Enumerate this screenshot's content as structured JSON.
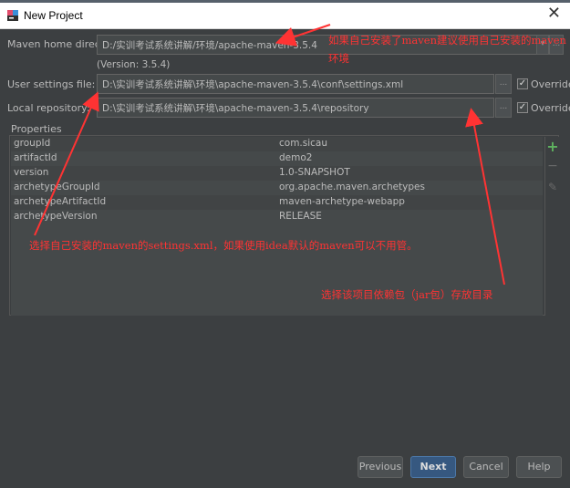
{
  "window": {
    "title": "New Project",
    "close_glyph": "✕"
  },
  "form": {
    "maven_home_label": "Maven home directory:",
    "maven_home_value": "D:/实训考试系统讲解/环境/apache-maven-3.5.4",
    "version_text": "(Version: 3.5.4)",
    "settings_label": "User settings file:",
    "settings_value": "D:\\实训考试系统讲解\\环境\\apache-maven-3.5.4\\conf\\settings.xml",
    "repo_label": "Local repository:",
    "repo_value": "D:\\实训考试系统讲解\\环境\\apache-maven-3.5.4\\repository",
    "override_label": "Override",
    "browse_label": "...",
    "dropdown_glyph": "▾"
  },
  "properties": {
    "legend": "Properties",
    "rows": [
      {
        "key": "groupId",
        "value": "com.sicau"
      },
      {
        "key": "artifactId",
        "value": "demo2"
      },
      {
        "key": "version",
        "value": "1.0-SNAPSHOT"
      },
      {
        "key": "archetypeGroupId",
        "value": "org.apache.maven.archetypes"
      },
      {
        "key": "archetypeArtifactId",
        "value": "maven-archetype-webapp"
      },
      {
        "key": "archetypeVersion",
        "value": "RELEASE"
      }
    ],
    "tools": {
      "add": "+",
      "remove": "−",
      "edit": "✎"
    }
  },
  "annotations": {
    "maven_home_line1": "如果自己安装了maven建议使用自己安装的maven",
    "maven_home_line2": "环境",
    "settings_note": "选择自己安装的maven的settings.xml，如果使用idea默认的maven可以不用管。",
    "repo_note": "选择该项目依赖包（jar包）存放目录"
  },
  "buttons": {
    "previous": "Previous",
    "next": "Next",
    "cancel": "Cancel",
    "help": "Help"
  },
  "colors": {
    "annotation": "#ff3333",
    "background": "#3c3f41",
    "primary_button": "#365880"
  }
}
